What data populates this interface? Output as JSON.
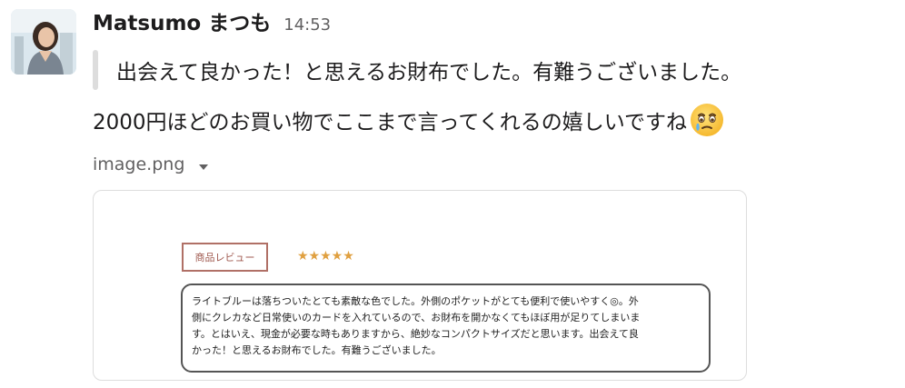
{
  "message": {
    "sender": "Matsumo まつも",
    "timestamp": "14:53",
    "quote_text": "出会えて良かった！と思えるお財布でした。有難うございました。",
    "body_text": "2000円ほどのお買い物でここまで言ってくれるの嬉しいですね",
    "emoji_name": "face-holding-back-tears-emoji"
  },
  "attachment": {
    "filename": "image.png",
    "caret_icon": "caret-down-icon",
    "preview": {
      "tag_label": "商品レビュー",
      "stars": "★★★★★",
      "star_rating": 5,
      "review_lines": [
        "ライトブルーは落ちついたとても素敵な色でした。外側のポケットがとても便利で使いやすく◎。外",
        "側にクレカなど日常使いのカードを入れているので、お財布を開かなくてもほぼ用が足りてしまいま",
        "す。とはいえ、現金が必要な時もありますから、絶妙なコンパクトサイズだと思います。出会えて良",
        "かった！と思えるお財布でした。有難うございました。"
      ]
    }
  },
  "colors": {
    "text": "#1d1c1d",
    "muted": "#616061",
    "quote_bar": "#dddddd",
    "tag_border": "#b07066",
    "stars": "#e0a040"
  }
}
